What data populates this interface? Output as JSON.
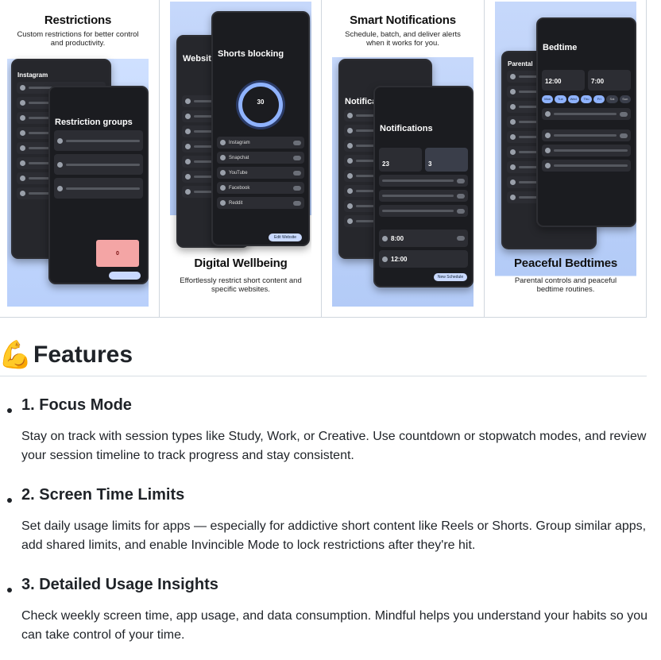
{
  "gallery": [
    {
      "title": "Restrictions",
      "subtitle": "Custom restrictions for better control and productivity.",
      "phone_title": "Restriction groups",
      "back_title": "Instagram",
      "tile_label": "0"
    },
    {
      "title": "Digital Wellbeing",
      "subtitle": "Effortlessly restrict short content and specific websites.",
      "phone_title": "Shorts blocking",
      "back_title": "Website",
      "ring_value": "30",
      "rows": [
        "Instagram",
        "Snapchat",
        "YouTube",
        "Facebook",
        "Reddit"
      ],
      "button": "Edit Website"
    },
    {
      "title": "Smart Notifications",
      "subtitle": "Schedule, batch, and deliver alerts when it works for you.",
      "phone_title": "Notifications",
      "back_title": "Notifica",
      "stat_1": "23",
      "stat_2": "3",
      "time_1": "8:00",
      "time_2": "12:00",
      "button": "New Schedule"
    },
    {
      "title": "Peaceful Bedtimes",
      "subtitle": "Parental controls and peaceful bedtime routines.",
      "phone_title": "Bedtime",
      "back_title": "Parental",
      "time_start": "12:00",
      "time_end": "7:00",
      "days": [
        "Mon",
        "Tue",
        "Wed",
        "Thu",
        "Fri",
        "Sat",
        "Sun"
      ]
    }
  ],
  "features": {
    "icon": "flexed-biceps-emoji",
    "icon_glyph": "💪",
    "title": "Features",
    "items": [
      {
        "heading": "1. Focus Mode",
        "body": "Stay on track with session types like Study, Work, or Creative. Use countdown or stopwatch modes, and review your session timeline to track progress and stay consistent."
      },
      {
        "heading": "2. Screen Time Limits",
        "body": "Set daily usage limits for apps — especially for addictive short content like Reels or Shorts. Group similar apps, add shared limits, and enable Invincible Mode to lock restrictions after they're hit."
      },
      {
        "heading": "3. Detailed Usage Insights",
        "body": "Check weekly screen time, app usage, and data consumption. Mindful helps you understand your habits so you can take control of your time."
      }
    ]
  },
  "colors": {
    "accent": "#8fb3ff",
    "promo_bg": "#c6d8fb",
    "phone_bg": "#1b1c20",
    "text": "#1f2328",
    "divider": "#d0d7de"
  }
}
